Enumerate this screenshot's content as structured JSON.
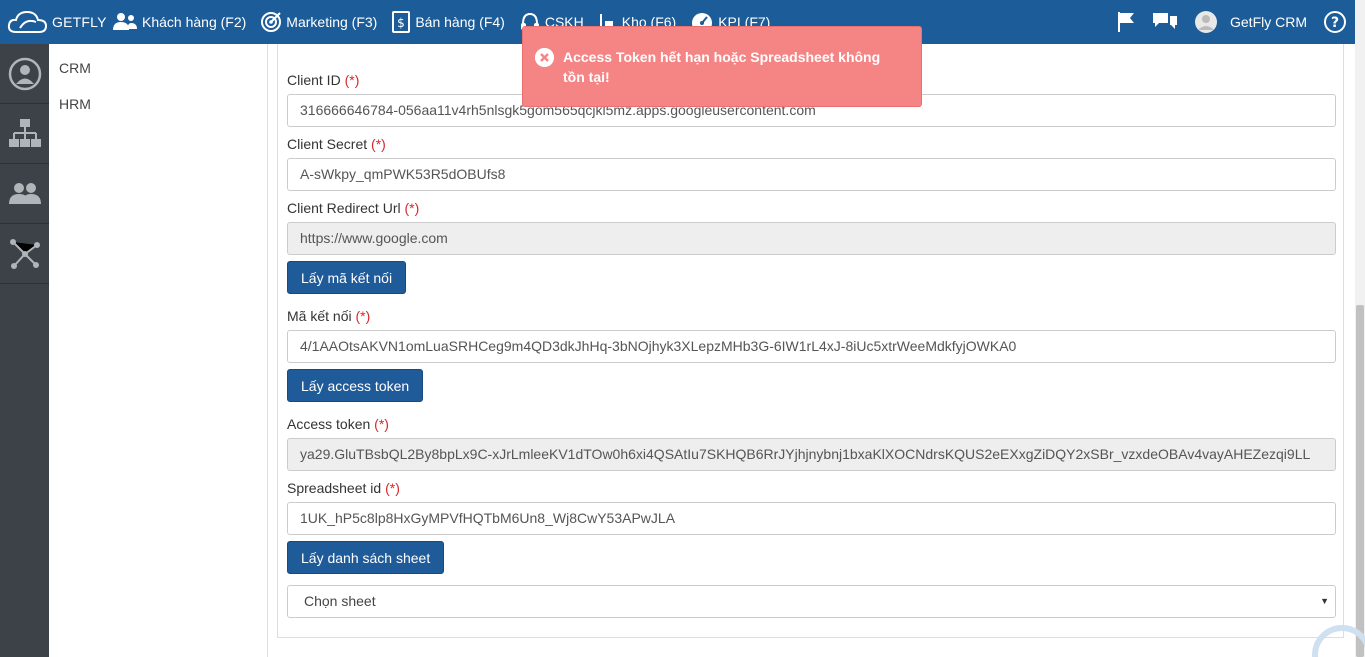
{
  "nav": {
    "brand": "GETFLY",
    "items": [
      {
        "label": "Khách hàng (F2)",
        "icon": "users-icon"
      },
      {
        "label": "Marketing (F3)",
        "icon": "target-icon"
      },
      {
        "label": "Bán hàng (F4)",
        "icon": "invoice-icon"
      },
      {
        "label": "CSKH",
        "icon": "headset-icon"
      },
      {
        "label": "Kho (F6)",
        "icon": "warehouse-icon"
      },
      {
        "label": "KPI (F7)",
        "icon": "speedometer-icon"
      }
    ],
    "user_name": "GetFly CRM"
  },
  "rail": {
    "icons": [
      "user-circle-icon",
      "org-chart-icon",
      "group-icon",
      "network-icon"
    ]
  },
  "submenu": {
    "items": [
      "CRM",
      "HRM"
    ]
  },
  "form": {
    "client_id": {
      "label": "Client ID",
      "required": "(*)",
      "value": "316666646784-056aa11v4rh5nlsgk5gom565qcjkl5mz.apps.googleusercontent.com"
    },
    "client_secret": {
      "label": "Client Secret",
      "required": "(*)",
      "value": "A-sWkpy_qmPWK53R5dOBUfs8"
    },
    "redirect_url": {
      "label": "Client Redirect Url",
      "required": "(*)",
      "value": "https://www.google.com"
    },
    "get_code_button": "Lấy mã kết nối",
    "auth_code": {
      "label": "Mã kết nối",
      "required": "(*)",
      "value": "4/1AAOtsAKVN1omLuaSRHCeg9m4QD3dkJhHq-3bNOjhyk3XLepzMHb3G-6IW1rL4xJ-8iUc5xtrWeeMdkfyjOWKA0"
    },
    "get_token_button": "Lấy access token",
    "access_token": {
      "label": "Access token",
      "required": "(*)",
      "value": "ya29.GluTBsbQL2By8bpLx9C-xJrLmleeKV1dTOw0h6xi4QSAtIu7SKHQB6RrJYjhjnybnj1bxaKlXOCNdrsKQUS2eEXxgZiDQY2xSBr_vzxdeOBAv4vayAHEZezqi9LL"
    },
    "spreadsheet_id": {
      "label": "Spreadsheet id",
      "required": "(*)",
      "value": "1UK_hP5c8lp8HxGyMPVfHQTbM6Un8_Wj8CwY53APwJLA"
    },
    "get_sheets_button": "Lấy danh sách sheet",
    "sheet_select": {
      "selected": "Chọn sheet"
    }
  },
  "toast": {
    "message": "Access Token hết hạn hoặc Spreadsheet không tồn tại!"
  },
  "colors": {
    "navbar": "#1b5c99",
    "button": "#1f5a99",
    "rail": "#3d4248",
    "toast": "#f58585",
    "required": "#d9262c"
  }
}
